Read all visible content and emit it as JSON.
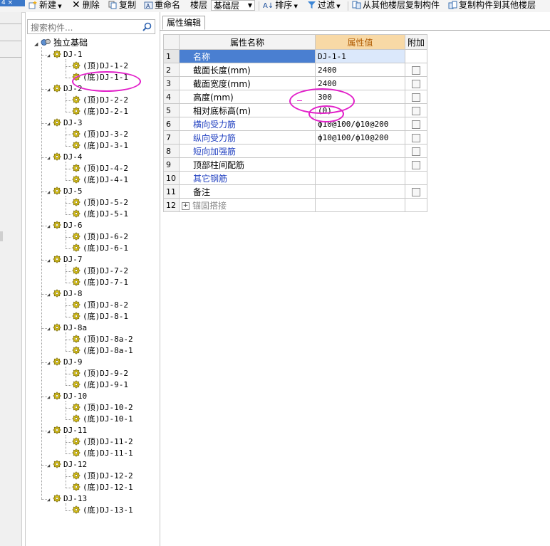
{
  "toolbar": {
    "corner_tab": "4 ×",
    "new_label": "新建",
    "delete_label": "删除",
    "copy_label": "复制",
    "rename_label": "重命名",
    "floor_label": "楼层",
    "floor_value": "基础层",
    "sort_label": "排序",
    "filter_label": "过滤",
    "copy_from_floor_label": "从其他楼层复制构件",
    "copy_to_floor_label": "复制构件到其他楼层"
  },
  "search": {
    "placeholder": "搜索构件..."
  },
  "tree": {
    "root": "独立基础",
    "groups": [
      {
        "name": "DJ-1",
        "children": [
          "(顶)DJ-1-2",
          "(底)DJ-1-1"
        ]
      },
      {
        "name": "DJ-2",
        "children": [
          "(顶)DJ-2-2",
          "(底)DJ-2-1"
        ]
      },
      {
        "name": "DJ-3",
        "children": [
          "(顶)DJ-3-2",
          "(底)DJ-3-1"
        ]
      },
      {
        "name": "DJ-4",
        "children": [
          "(顶)DJ-4-2",
          "(底)DJ-4-1"
        ]
      },
      {
        "name": "DJ-5",
        "children": [
          "(顶)DJ-5-2",
          "(底)DJ-5-1"
        ]
      },
      {
        "name": "DJ-6",
        "children": [
          "(顶)DJ-6-2",
          "(底)DJ-6-1"
        ]
      },
      {
        "name": "DJ-7",
        "children": [
          "(顶)DJ-7-2",
          "(底)DJ-7-1"
        ]
      },
      {
        "name": "DJ-8",
        "children": [
          "(顶)DJ-8-2",
          "(底)DJ-8-1"
        ]
      },
      {
        "name": "DJ-8a",
        "children": [
          "(顶)DJ-8a-2",
          "(底)DJ-8a-1"
        ]
      },
      {
        "name": "DJ-9",
        "children": [
          "(顶)DJ-9-2",
          "(底)DJ-9-1"
        ]
      },
      {
        "name": "DJ-10",
        "children": [
          "(顶)DJ-10-2",
          "(底)DJ-10-1"
        ]
      },
      {
        "name": "DJ-11",
        "children": [
          "(顶)DJ-11-2",
          "(底)DJ-11-1"
        ]
      },
      {
        "name": "DJ-12",
        "children": [
          "(顶)DJ-12-2",
          "(底)DJ-12-1"
        ]
      },
      {
        "name": "DJ-13",
        "children": [
          "(底)DJ-13-1"
        ]
      }
    ]
  },
  "tabs": {
    "property_edit": "属性编辑"
  },
  "grid": {
    "headers": {
      "name": "属性名称",
      "value": "属性值",
      "extra": "附加"
    },
    "rows": [
      {
        "num": "1",
        "name": "名称",
        "value": "DJ-1-1",
        "style": "sel",
        "check": false
      },
      {
        "num": "2",
        "name": "截面长度(mm)",
        "value": "2400",
        "style": "",
        "check": true
      },
      {
        "num": "3",
        "name": "截面宽度(mm)",
        "value": "2400",
        "style": "",
        "check": true
      },
      {
        "num": "4",
        "name": "高度(mm)",
        "value": "300",
        "style": "",
        "check": true
      },
      {
        "num": "5",
        "name": "相对底标高(m)",
        "value": "(0)",
        "style": "",
        "check": true
      },
      {
        "num": "6",
        "name": "横向受力筋",
        "value": "ф10@100/ф10@200",
        "style": "blue",
        "check": true
      },
      {
        "num": "7",
        "name": "纵向受力筋",
        "value": "ф10@100/ф10@200",
        "style": "blue",
        "check": true
      },
      {
        "num": "8",
        "name": "短向加强筋",
        "value": "",
        "style": "blue",
        "check": true
      },
      {
        "num": "9",
        "name": "顶部柱间配筋",
        "value": "",
        "style": "",
        "check": true
      },
      {
        "num": "10",
        "name": "其它钢筋",
        "value": "",
        "style": "blue",
        "check": false
      },
      {
        "num": "11",
        "name": "备注",
        "value": "",
        "style": "",
        "check": true
      },
      {
        "num": "12",
        "name": "锚固搭接",
        "value": "",
        "style": "grey",
        "check": false,
        "expandable": true
      }
    ]
  },
  "colors": {
    "selection": "#4a7fd1",
    "value_header": "#f8d9a6",
    "annotation": "#e21fc9",
    "blue_text": "#2140c0"
  }
}
